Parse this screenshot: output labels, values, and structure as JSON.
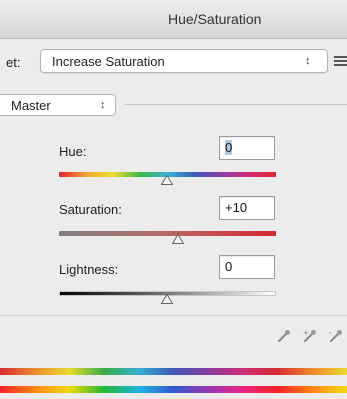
{
  "window": {
    "title": "Hue/Saturation"
  },
  "preset": {
    "label": "et:",
    "selected": "Increase Saturation"
  },
  "channel": {
    "selected": "Master"
  },
  "adjustments": {
    "hue": {
      "label": "Hue:",
      "value": "0"
    },
    "saturation": {
      "label": "Saturation:",
      "value": "+10"
    },
    "lightness": {
      "label": "Lightness:",
      "value": "0"
    }
  },
  "icons": {
    "updown": "up-down-arrows-icon",
    "preset_menu": "list-menu-icon",
    "eyedropper": "eyedropper-icon",
    "eyedropper_plus": "eyedropper-plus-icon",
    "eyedropper_minus": "eyedropper-minus-icon"
  },
  "colors": {
    "field_focus_highlight": "#aac8ee",
    "saturation_track_end": "#d8262f"
  }
}
